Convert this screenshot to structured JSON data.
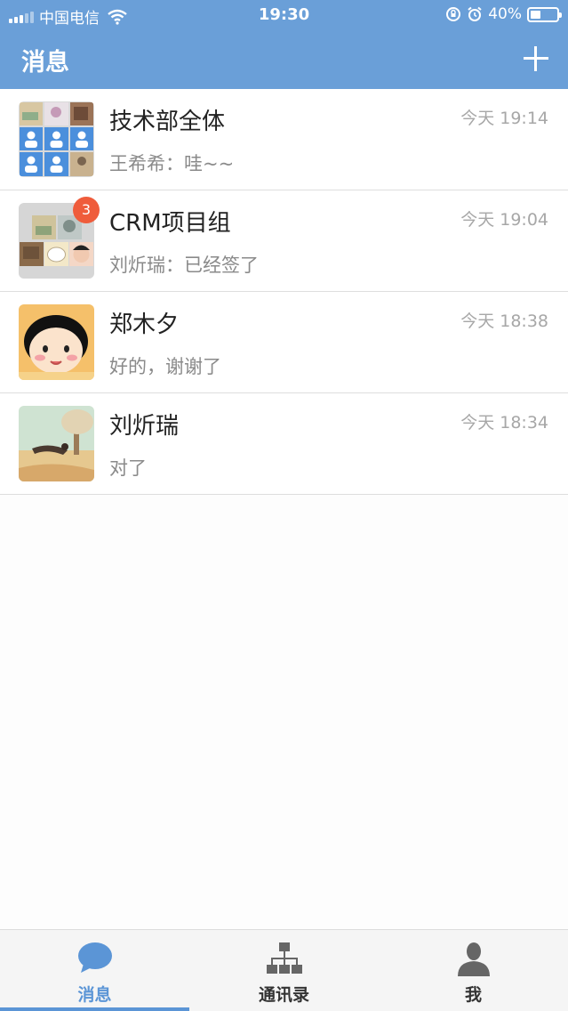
{
  "status_bar": {
    "carrier": "中国电信",
    "time": "19:30",
    "battery": "40%",
    "battery_level": 0.4
  },
  "navbar": {
    "title": "消息"
  },
  "conversations": [
    {
      "name": "技术部全体",
      "preview": "王希希：哇~~",
      "time": "今天 19:14",
      "badge": null
    },
    {
      "name": "CRM项目组",
      "preview": "刘炘瑞：已经签了",
      "time": "今天 19:04",
      "badge": "3"
    },
    {
      "name": "郑木夕",
      "preview": "好的，谢谢了",
      "time": "今天 18:38",
      "badge": null
    },
    {
      "name": "刘炘瑞",
      "preview": "对了",
      "time": "今天 18:34",
      "badge": null
    }
  ],
  "tabbar": {
    "tabs": [
      {
        "label": "消息",
        "icon": "chat-bubble-icon",
        "active": true
      },
      {
        "label": "通讯录",
        "icon": "org-chart-icon",
        "active": false
      },
      {
        "label": "我",
        "icon": "person-icon",
        "active": false
      }
    ]
  },
  "colors": {
    "header": "#6a9fd8",
    "accent": "#5b95d6",
    "badge": "#ef5c3b"
  }
}
